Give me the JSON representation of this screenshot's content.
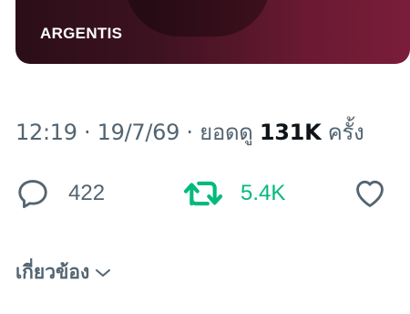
{
  "media": {
    "caption": "ARGENTIS"
  },
  "meta": {
    "time": "12:19",
    "separator1": " · ",
    "date": "19/7/69",
    "separator2": " · ",
    "views_label": "ยอดดู ",
    "views_count": "131K",
    "views_suffix": " ครั้ง"
  },
  "actions": {
    "reply_icon": "reply-icon",
    "reply_count": "422",
    "retweet_icon": "retweet-icon",
    "retweet_count": "5.4K",
    "like_icon": "heart-icon"
  },
  "related": {
    "label": "เกี่ยวข้อง",
    "icon": "chevron-down-icon"
  },
  "colors": {
    "text_secondary": "#536471",
    "text_primary": "#0f1419",
    "retweet_accent": "#00ba7c"
  }
}
